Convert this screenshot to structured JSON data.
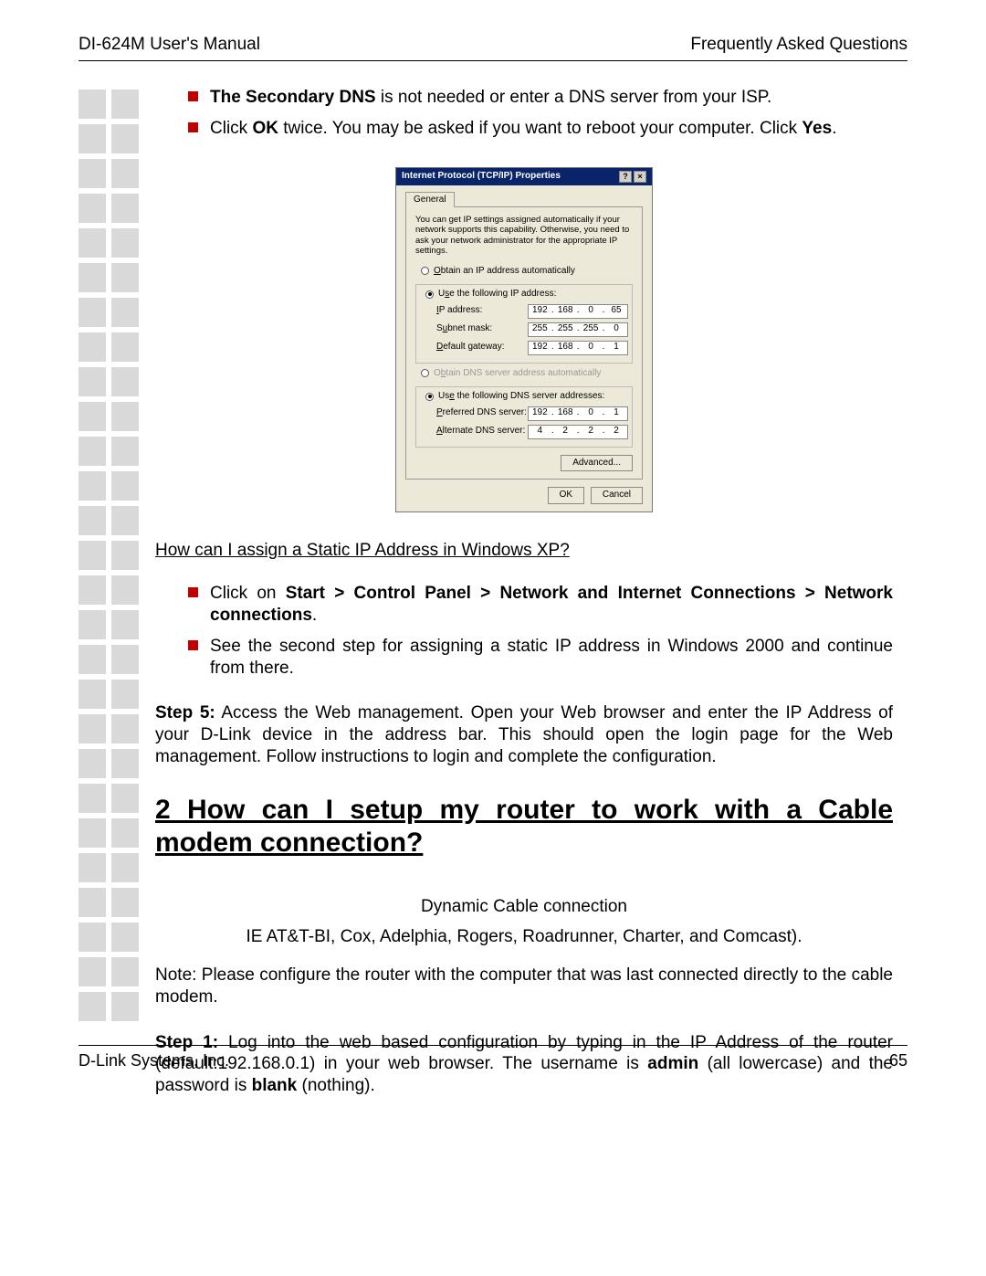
{
  "header": {
    "left": "DI-624M User's Manual",
    "right": "Frequently Asked Questions"
  },
  "bullets_top": {
    "b1_pre": "The Secondary DNS",
    "b1_rest": " is not needed or enter a DNS server from your ISP.",
    "b2_p1": "Click ",
    "b2_ok": "OK",
    "b2_p2": " twice. You may be asked if you want to reboot your computer. Click ",
    "b2_yes": "Yes",
    "b2_p3": "."
  },
  "dialog": {
    "title": "Internet Protocol (TCP/IP) Properties",
    "help_btn": "?",
    "close_btn": "×",
    "tab": "General",
    "desc": "You can get IP settings assigned automatically if your network supports this capability. Otherwise, you need to ask your network administrator for the appropriate IP settings.",
    "radio_auto_ip": "Obtain an IP address automatically",
    "radio_use_ip": "Use the following IP address:",
    "ip_label": "IP address:",
    "ip": [
      "192",
      "168",
      "0",
      "65"
    ],
    "subnet_label": "Subnet mask:",
    "subnet": [
      "255",
      "255",
      "255",
      "0"
    ],
    "gateway_label": "Default gateway:",
    "gateway": [
      "192",
      "168",
      "0",
      "1"
    ],
    "radio_auto_dns": "Obtain DNS server address automatically",
    "radio_use_dns": "Use the following DNS server addresses:",
    "pref_dns_label": "Preferred DNS server:",
    "pref_dns": [
      "192",
      "168",
      "0",
      "1"
    ],
    "alt_dns_label": "Alternate DNS server:",
    "alt_dns": [
      "4",
      "2",
      "2",
      "2"
    ],
    "advanced": "Advanced...",
    "ok": "OK",
    "cancel": "Cancel"
  },
  "q_xp": "How can I assign a Static IP Address in Windows XP?",
  "bullets_xp": {
    "b1_p1": "Click on ",
    "b1_bold": "Start > Control Panel > Network and Internet Connections > Network connections",
    "b1_p2": ".",
    "b2": "See the second step for assigning a static IP address in Windows 2000 and continue from there."
  },
  "step5": {
    "label": "Step 5:",
    "text": " Access the Web management. Open your Web browser and enter the IP Address of your D-Link device in the address bar. This should open the login page for the Web management. Follow instructions to login and complete the configuration."
  },
  "heading2": "2 How can I setup my router to work with a Cable modem connection?",
  "cable": {
    "line1": "Dynamic Cable connection",
    "line2": "IE AT&T-BI, Cox, Adelphia, Rogers, Roadrunner, Charter, and Comcast).",
    "note": "Note: Please configure the router with the computer that was last connected directly to the cable modem."
  },
  "step1": {
    "label": "Step 1:",
    "p1": " Log into the web based configuration by typing in the IP Address of the router (default:192.168.0.1) in your web browser. The username is ",
    "admin": "admin",
    "p2": " (all lowercase) and the password is ",
    "blank": "blank",
    "p3": " (nothing)."
  },
  "footer": {
    "left": "D-Link Systems, Inc.",
    "right": "65"
  }
}
